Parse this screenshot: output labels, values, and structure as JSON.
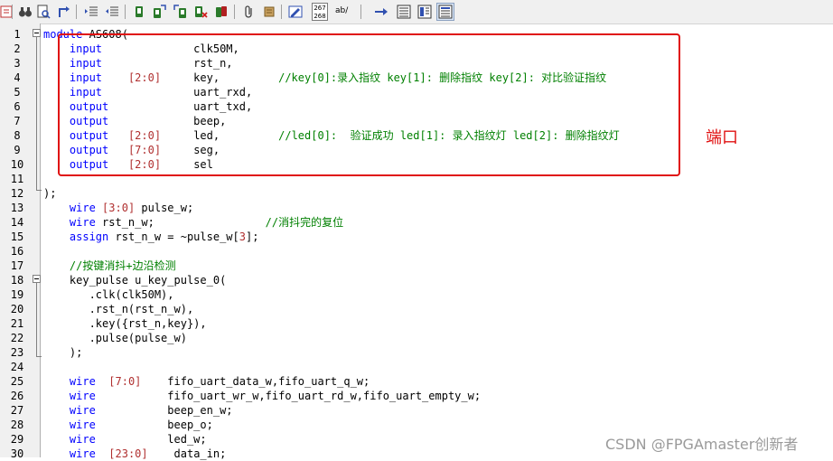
{
  "toolbar": {
    "icons": [
      "export-icon",
      "binoculars-icon",
      "find-in-files-icon",
      "replace-icon",
      "indent-icon",
      "unindent-icon",
      "bookmark-icon",
      "bookmark-next-icon",
      "bookmark-prev-icon",
      "bookmark-clear-icon",
      "bookmark-all-icon",
      "attach-icon",
      "script-icon",
      "template-icon",
      "line-numbers-icon",
      "spell-icon",
      "arrow-icon",
      "column-icon",
      "column-select-icon",
      "layout-icon"
    ],
    "line_counter": {
      "top": "267",
      "bottom": "268"
    },
    "ab_label": "ab/"
  },
  "annotation": {
    "label": "端口",
    "color": "#e01010"
  },
  "watermark": "CSDN @FPGAmaster创新者",
  "colors": {
    "keyword": "#0000ff",
    "number": "#b03030",
    "comment": "#008000"
  },
  "lines": [
    {
      "n": "1",
      "segs": [
        {
          "c": "kw",
          "t": "module"
        },
        {
          "c": "",
          "t": " AS608("
        }
      ]
    },
    {
      "n": "2",
      "segs": [
        {
          "c": "",
          "t": "    "
        },
        {
          "c": "kw",
          "t": "input"
        },
        {
          "c": "",
          "t": "              clk50M,"
        }
      ]
    },
    {
      "n": "3",
      "segs": [
        {
          "c": "",
          "t": "    "
        },
        {
          "c": "kw",
          "t": "input"
        },
        {
          "c": "",
          "t": "              rst_n,"
        }
      ]
    },
    {
      "n": "4",
      "segs": [
        {
          "c": "",
          "t": "    "
        },
        {
          "c": "kw",
          "t": "input"
        },
        {
          "c": "",
          "t": "    "
        },
        {
          "c": "nm",
          "t": "[2:0]"
        },
        {
          "c": "",
          "t": "     key,         "
        },
        {
          "c": "cm",
          "t": "//key[0]:录入指纹 key[1]: 删除指纹 key[2]: 对比验证指纹"
        }
      ]
    },
    {
      "n": "5",
      "segs": [
        {
          "c": "",
          "t": "    "
        },
        {
          "c": "kw",
          "t": "input"
        },
        {
          "c": "",
          "t": "              uart_rxd,"
        }
      ]
    },
    {
      "n": "6",
      "segs": [
        {
          "c": "",
          "t": "    "
        },
        {
          "c": "kw",
          "t": "output"
        },
        {
          "c": "",
          "t": "             uart_txd,"
        }
      ]
    },
    {
      "n": "7",
      "segs": [
        {
          "c": "",
          "t": "    "
        },
        {
          "c": "kw",
          "t": "output"
        },
        {
          "c": "",
          "t": "             beep,"
        }
      ]
    },
    {
      "n": "8",
      "segs": [
        {
          "c": "",
          "t": "    "
        },
        {
          "c": "kw",
          "t": "output"
        },
        {
          "c": "",
          "t": "   "
        },
        {
          "c": "nm",
          "t": "[2:0]"
        },
        {
          "c": "",
          "t": "     led,         "
        },
        {
          "c": "cm",
          "t": "//led[0]:  验证成功 led[1]: 录入指纹灯 led[2]: 删除指纹灯"
        }
      ]
    },
    {
      "n": "9",
      "segs": [
        {
          "c": "",
          "t": "    "
        },
        {
          "c": "kw",
          "t": "output"
        },
        {
          "c": "",
          "t": "   "
        },
        {
          "c": "nm",
          "t": "[7:0]"
        },
        {
          "c": "",
          "t": "     seg,"
        }
      ]
    },
    {
      "n": "10",
      "segs": [
        {
          "c": "",
          "t": "    "
        },
        {
          "c": "kw",
          "t": "output"
        },
        {
          "c": "",
          "t": "   "
        },
        {
          "c": "nm",
          "t": "[2:0]"
        },
        {
          "c": "",
          "t": "     sel"
        }
      ]
    },
    {
      "n": "11",
      "segs": []
    },
    {
      "n": "12",
      "segs": [
        {
          "c": "",
          "t": ");"
        }
      ]
    },
    {
      "n": "13",
      "segs": [
        {
          "c": "",
          "t": "    "
        },
        {
          "c": "kw",
          "t": "wire"
        },
        {
          "c": "",
          "t": " "
        },
        {
          "c": "nm",
          "t": "[3:0]"
        },
        {
          "c": "",
          "t": " pulse_w;"
        }
      ]
    },
    {
      "n": "14",
      "segs": [
        {
          "c": "",
          "t": "    "
        },
        {
          "c": "kw",
          "t": "wire"
        },
        {
          "c": "",
          "t": " rst_n_w;                 "
        },
        {
          "c": "cm",
          "t": "//消抖完的复位"
        }
      ]
    },
    {
      "n": "15",
      "segs": [
        {
          "c": "",
          "t": "    "
        },
        {
          "c": "kw",
          "t": "assign"
        },
        {
          "c": "",
          "t": " rst_n_w = ~pulse_w["
        },
        {
          "c": "nm",
          "t": "3"
        },
        {
          "c": "",
          "t": "];"
        }
      ]
    },
    {
      "n": "16",
      "segs": []
    },
    {
      "n": "17",
      "segs": [
        {
          "c": "",
          "t": "    "
        },
        {
          "c": "cm",
          "t": "//按键消抖+边沿检测"
        }
      ]
    },
    {
      "n": "18",
      "segs": [
        {
          "c": "",
          "t": "    key_pulse u_key_pulse_0("
        }
      ]
    },
    {
      "n": "19",
      "segs": [
        {
          "c": "",
          "t": "       .clk(clk50M),"
        }
      ]
    },
    {
      "n": "20",
      "segs": [
        {
          "c": "",
          "t": "       .rst_n(rst_n_w),"
        }
      ]
    },
    {
      "n": "21",
      "segs": [
        {
          "c": "",
          "t": "       .key({rst_n,key}),"
        }
      ]
    },
    {
      "n": "22",
      "segs": [
        {
          "c": "",
          "t": "       .pulse(pulse_w)"
        }
      ]
    },
    {
      "n": "23",
      "segs": [
        {
          "c": "",
          "t": "    );"
        }
      ]
    },
    {
      "n": "24",
      "segs": []
    },
    {
      "n": "25",
      "segs": [
        {
          "c": "",
          "t": "    "
        },
        {
          "c": "kw",
          "t": "wire"
        },
        {
          "c": "",
          "t": "  "
        },
        {
          "c": "nm",
          "t": "[7:0]"
        },
        {
          "c": "",
          "t": "    fifo_uart_data_w,fifo_uart_q_w;"
        }
      ]
    },
    {
      "n": "26",
      "segs": [
        {
          "c": "",
          "t": "    "
        },
        {
          "c": "kw",
          "t": "wire"
        },
        {
          "c": "",
          "t": "           fifo_uart_wr_w,fifo_uart_rd_w,fifo_uart_empty_w;"
        }
      ]
    },
    {
      "n": "27",
      "segs": [
        {
          "c": "",
          "t": "    "
        },
        {
          "c": "kw",
          "t": "wire"
        },
        {
          "c": "",
          "t": "           beep_en_w;"
        }
      ]
    },
    {
      "n": "28",
      "segs": [
        {
          "c": "",
          "t": "    "
        },
        {
          "c": "kw",
          "t": "wire"
        },
        {
          "c": "",
          "t": "           beep_o;"
        }
      ]
    },
    {
      "n": "29",
      "segs": [
        {
          "c": "",
          "t": "    "
        },
        {
          "c": "kw",
          "t": "wire"
        },
        {
          "c": "",
          "t": "           led_w;"
        }
      ]
    },
    {
      "n": "30",
      "segs": [
        {
          "c": "",
          "t": "    "
        },
        {
          "c": "kw",
          "t": "wire"
        },
        {
          "c": "",
          "t": "  "
        },
        {
          "c": "nm",
          "t": "[23:0]"
        },
        {
          "c": "",
          "t": "    data_in;"
        }
      ]
    }
  ]
}
